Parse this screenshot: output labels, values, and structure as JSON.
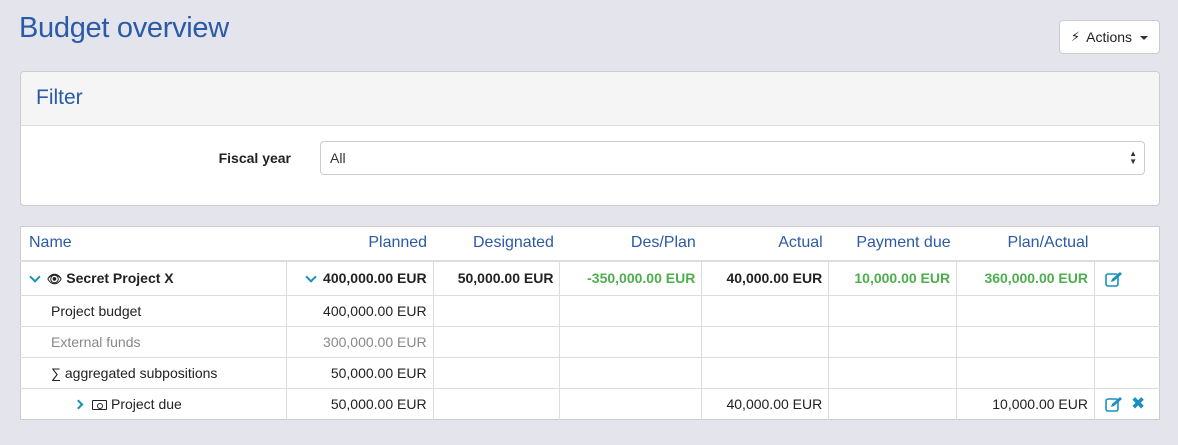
{
  "page": {
    "title": "Budget overview"
  },
  "actions_button": {
    "label": "Actions",
    "icon": "bolt-icon"
  },
  "filter": {
    "heading": "Filter",
    "fiscal_year_label": "Fiscal year",
    "fiscal_year_value": "All"
  },
  "table": {
    "columns": [
      "Name",
      "Planned",
      "Designated",
      "Des/Plan",
      "Actual",
      "Payment due",
      "Plan/Actual"
    ],
    "project": {
      "name": "Secret Project X",
      "planned": "400,000.00 EUR",
      "designated": "50,000.00 EUR",
      "des_plan": "-350,000.00 EUR",
      "actual": "40,000.00 EUR",
      "payment_due": "10,000.00 EUR",
      "plan_actual": "360,000.00 EUR"
    },
    "rows": [
      {
        "name": "Project budget",
        "planned": "400,000.00 EUR"
      },
      {
        "name": "External funds",
        "planned": "300,000.00 EUR"
      },
      {
        "name": "∑ aggregated subpositions",
        "planned": "50,000.00 EUR"
      },
      {
        "name": "Project due",
        "planned": "50,000.00 EUR",
        "actual": "40,000.00 EUR",
        "plan_actual": "10,000.00 EUR"
      }
    ]
  },
  "colors": {
    "accent": "#2b5aa6",
    "positive": "#4cae4c",
    "link": "#1a90c0"
  }
}
